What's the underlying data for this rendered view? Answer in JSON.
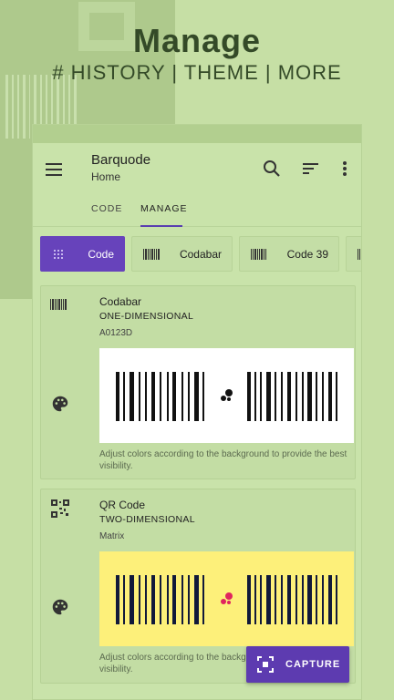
{
  "promo": {
    "title": "Manage",
    "subtitle": "# HISTORY | THEME | MORE"
  },
  "appbar": {
    "title": "Barquode",
    "subtitle": "Home",
    "icons": [
      "menu-icon",
      "search-icon",
      "sort-icon",
      "more-vert-icon"
    ]
  },
  "tabs": [
    {
      "label": "CODE",
      "active": false
    },
    {
      "label": "MANAGE",
      "active": true
    }
  ],
  "chips": [
    {
      "label": "Code",
      "active": true
    },
    {
      "label": "Codabar",
      "active": false
    },
    {
      "label": "Code 39",
      "active": false
    }
  ],
  "cards": [
    {
      "name": "Codabar",
      "category": "ONE-DIMENSIONAL",
      "value": "A0123D",
      "note": "Adjust colors according to the background to provide the best visibility.",
      "preview_bg": "#ffffff",
      "bar_color": "#111111",
      "dot_color": "#111111"
    },
    {
      "name": "QR Code",
      "category": "TWO-DIMENSIONAL",
      "value": "Matrix",
      "note": "Adjust colors according to the background to provide the best visibility.",
      "preview_bg": "#fdf07a",
      "bar_color": "#11193a",
      "dot_color": "#e0245e"
    }
  ],
  "fab": {
    "label": "CAPTURE",
    "icon": "capture-icon"
  },
  "colors": {
    "background": "#c6dfa5",
    "accent": "#5d3bb0",
    "chip_active": "#6743bb"
  }
}
